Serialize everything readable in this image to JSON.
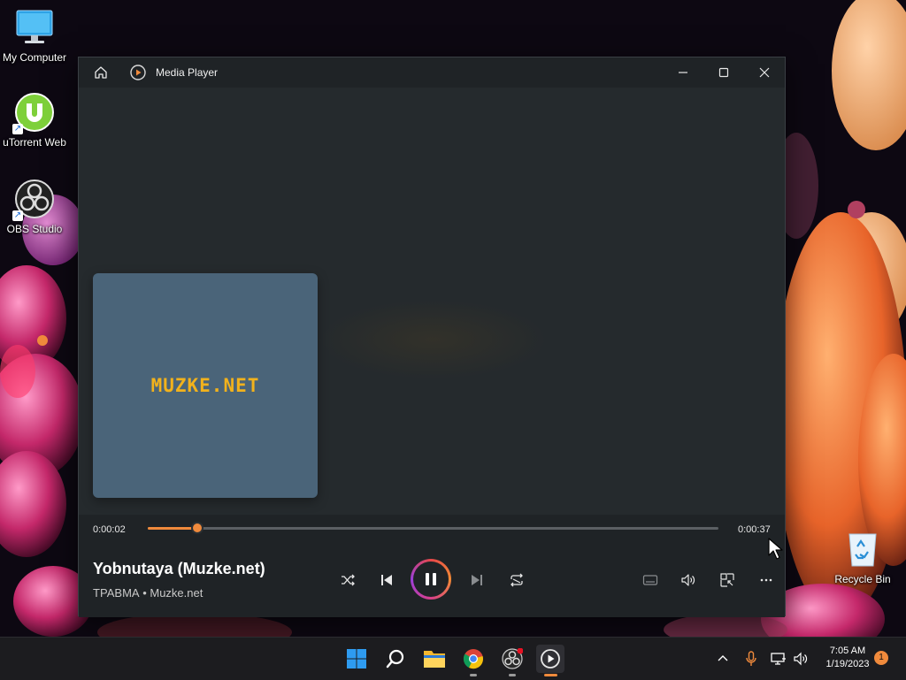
{
  "desktop": {
    "icons": [
      {
        "label": "My Computer",
        "icon": "monitor-icon"
      },
      {
        "label": "uTorrent Web",
        "icon": "utorrent-icon"
      },
      {
        "label": "OBS Studio",
        "icon": "obs-icon"
      },
      {
        "label": "Recycle Bin",
        "icon": "recycle-bin-icon"
      }
    ]
  },
  "window": {
    "title": "Media Player",
    "home_icon": "home-icon",
    "app_icon": "play-circle-icon",
    "controls": [
      "minimize-icon",
      "maximize-icon",
      "close-icon"
    ]
  },
  "player": {
    "album_art_text": "MUZKE.NET",
    "elapsed": "0:00:02",
    "duration": "0:00:37",
    "progress_fraction": 0.087,
    "track_title": "Yobnutaya (Muzke.net)",
    "track_subtitle": "ТРАВМА • Muzke.net",
    "state": "playing",
    "buttons": [
      "shuffle-icon",
      "previous-icon",
      "pause-icon",
      "next-icon",
      "repeat-icon",
      "captions-icon",
      "volume-icon",
      "mini-player-icon",
      "more-options-icon"
    ]
  },
  "taskbar": {
    "apps": [
      "windows-start-icon",
      "search-icon",
      "file-explorer-icon",
      "chrome-icon",
      "obs-icon",
      "media-player-icon"
    ],
    "tray_icons": [
      "chevron-up-icon",
      "microphone-icon",
      "network-icon",
      "speaker-icon"
    ],
    "time": "7:05 AM",
    "date": "1/19/2023",
    "notification_count": "1"
  },
  "colors": {
    "accent": "#f08a3c",
    "album_bg": "#4a6479",
    "album_text": "#f2b21c",
    "player_bg": "#1f2326"
  }
}
